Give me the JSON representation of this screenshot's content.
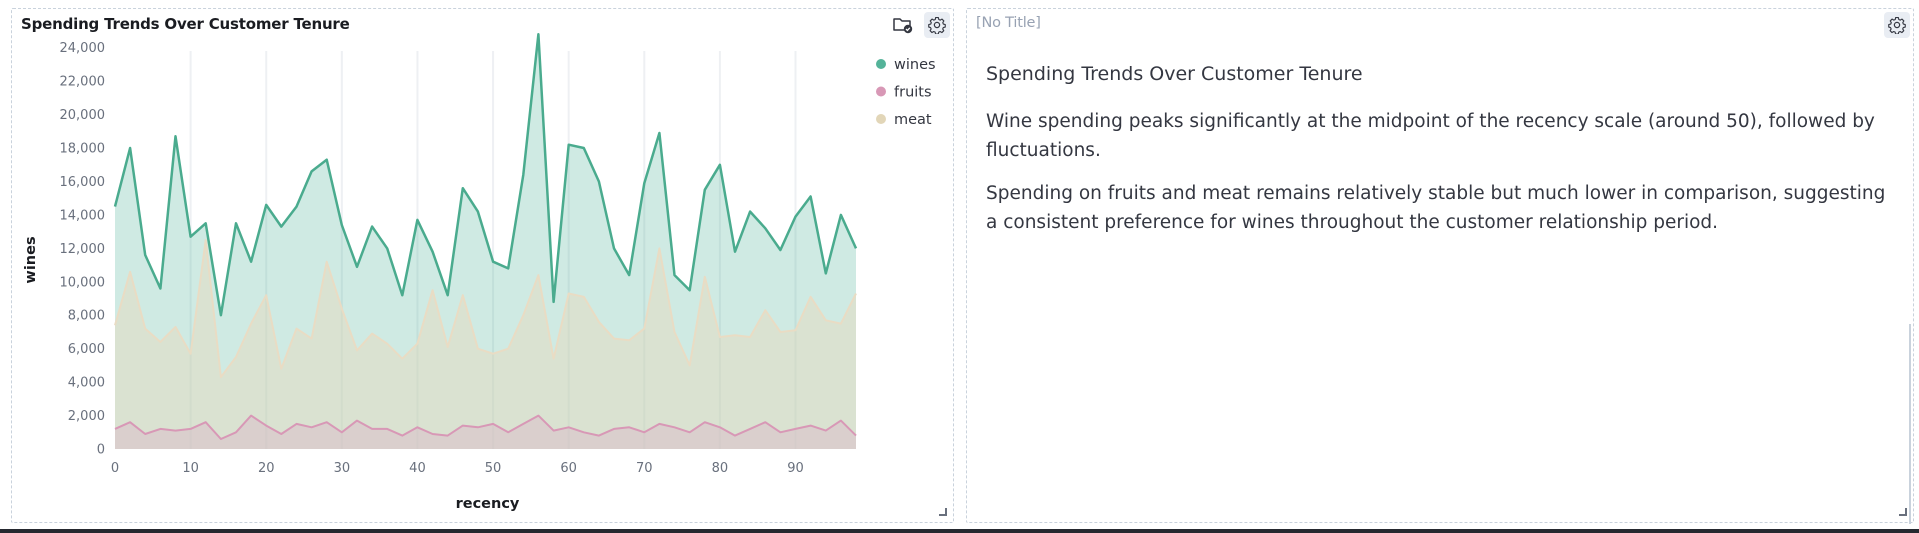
{
  "left_panel": {
    "title": "Spending Trends Over Customer Tenure",
    "icons": {
      "folder": "folder-check-icon",
      "gear": "gear-icon"
    }
  },
  "right_panel": {
    "title": "[No Title]",
    "heading": "Spending Trends Over Customer Tenure",
    "paragraph1": "Wine spending peaks significantly at the midpoint of the recency scale (around 50), followed by fluctuations.",
    "paragraph2": "Spending on fruits and meat remains relatively stable but much lower in comparison, suggesting a consistent preference for wines throughout the customer relationship period."
  },
  "chart_data": {
    "type": "area",
    "xlabel": "recency",
    "ylabel": "wines",
    "xlim": [
      0,
      98
    ],
    "ylim": [
      0,
      25000
    ],
    "x_ticks": [
      0,
      10,
      20,
      30,
      40,
      50,
      60,
      70,
      80,
      90
    ],
    "y_ticks": [
      0,
      2000,
      4000,
      6000,
      8000,
      10000,
      12000,
      14000,
      16000,
      18000,
      20000,
      22000,
      24000
    ],
    "y_tick_labels": [
      "0",
      "2,000",
      "4,000",
      "6,000",
      "8,000",
      "10,000",
      "12,000",
      "14,000",
      "16,000",
      "18,000",
      "20,000",
      "22,000",
      "24,000"
    ],
    "grid": "vertical",
    "legend_position": "top-right",
    "x": [
      0,
      2,
      4,
      6,
      8,
      10,
      12,
      14,
      16,
      18,
      20,
      22,
      24,
      26,
      28,
      30,
      32,
      34,
      36,
      38,
      40,
      42,
      44,
      46,
      48,
      50,
      52,
      54,
      56,
      58,
      60,
      62,
      64,
      66,
      68,
      70,
      72,
      74,
      76,
      78,
      80,
      82,
      84,
      86,
      88,
      90,
      92,
      94,
      96,
      98
    ],
    "series": [
      {
        "name": "wines",
        "color": "#54b399",
        "values": [
          14500,
          18000,
          11600,
          9600,
          18700,
          12700,
          13500,
          8000,
          13500,
          11200,
          14600,
          13300,
          14500,
          16600,
          17300,
          13400,
          10900,
          13300,
          12000,
          9200,
          13700,
          11800,
          9200,
          15600,
          14200,
          11200,
          10800,
          16400,
          24800,
          8800,
          18200,
          18000,
          16000,
          12000,
          10400,
          15900,
          18900,
          10400,
          9500,
          15500,
          17000,
          11800,
          14200,
          13200,
          11900,
          13900,
          15100,
          10500,
          14000,
          12000
        ]
      },
      {
        "name": "fruits",
        "color": "#d6bf57",
        "values": [
          1200,
          1600,
          900,
          1200,
          1100,
          1200,
          1600,
          600,
          1000,
          2000,
          1400,
          900,
          1500,
          1300,
          1600,
          1000,
          1700,
          1200,
          1200,
          800,
          1300,
          900,
          800,
          1400,
          1300,
          1500,
          1000,
          1500,
          2000,
          1100,
          1300,
          1000,
          800,
          1200,
          1300,
          1000,
          1500,
          1300,
          1000,
          1600,
          1300,
          800,
          1200,
          1600,
          1000,
          1200,
          1400,
          1100,
          1700,
          800
        ]
      },
      {
        "name": "meat",
        "color": "#e7d9bb",
        "values": [
          7400,
          10600,
          7200,
          6400,
          7300,
          5700,
          12500,
          4300,
          5500,
          7500,
          9200,
          4800,
          7200,
          6600,
          11200,
          8400,
          5900,
          6900,
          6300,
          5400,
          6300,
          9500,
          6100,
          9200,
          6000,
          5700,
          6000,
          8000,
          10400,
          5400,
          9300,
          9100,
          7600,
          6600,
          6500,
          7200,
          12000,
          7000,
          5000,
          10300,
          6700,
          6800,
          6700,
          8300,
          7000,
          7100,
          9100,
          7700,
          7500,
          9300
        ]
      }
    ]
  }
}
